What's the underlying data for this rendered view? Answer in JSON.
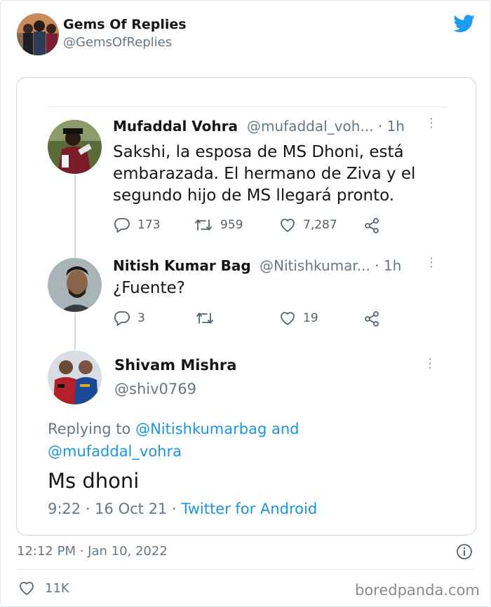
{
  "embed": {
    "author_name": "Gems Of Replies",
    "author_handle": "@GemsOfReplies",
    "timestamp": "12:12 PM · Jan 10, 2022",
    "likes": "11K",
    "watermark": "boredpanda.com",
    "brand_color": "#1d9bf0"
  },
  "thread": {
    "tweet1": {
      "name": "Mufaddal Vohra",
      "handle_time": "@mufaddal_voh... · 1h",
      "text_line1": "Sakshi, la esposa de MS Dhoni, está",
      "text_line2": "embarazada. El hermano de Ziva y el",
      "text_line3": "segundo hijo de MS llegará pronto.",
      "replies": "173",
      "retweets": "959",
      "likes": "7,287"
    },
    "tweet2": {
      "name": "Nitish Kumar Bag",
      "handle_time": "@Nitishkumar... · 1h",
      "text": "¿Fuente?",
      "replies": "3",
      "likes": "19"
    },
    "tweet3": {
      "name": "Shivam Mishra",
      "handle": "@shiv0769",
      "replying_prefix": "Replying to",
      "replying_user1": "@Nitishkumarbag",
      "replying_and": "and",
      "replying_user2": "@mufaddal_vohra",
      "text": "Ms dhoni",
      "time": "9:22 · 16 Oct 21",
      "source": "Twitter for Android"
    }
  }
}
